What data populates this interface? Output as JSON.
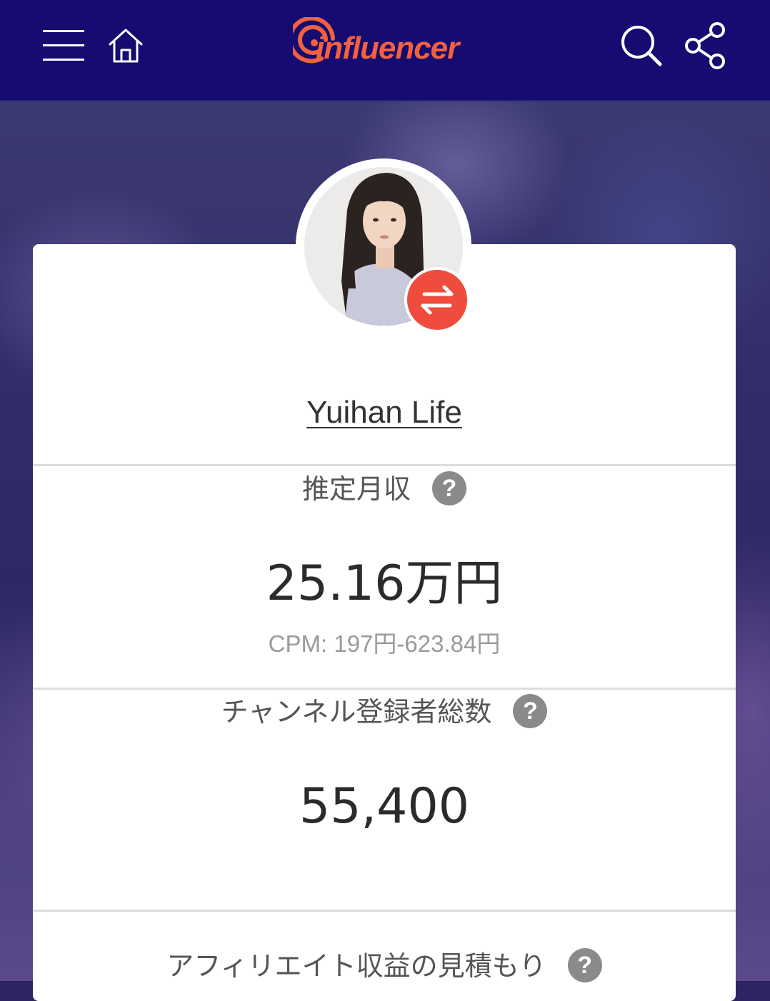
{
  "header": {
    "logo_text": "influencer",
    "icons": {
      "menu": "hamburger-menu-icon",
      "home": "home-icon",
      "search": "search-icon",
      "share": "share-icon"
    }
  },
  "profile": {
    "channel_name": "Yuihan Life",
    "swap_icon": "swap-arrows-icon"
  },
  "stats": {
    "monthly_income": {
      "label": "推定月収",
      "help": "?",
      "value": "25.16万円",
      "cpm": "CPM: 197円-623.84円"
    },
    "subscribers": {
      "label": "チャンネル登録者総数",
      "help": "?",
      "value": "55,400"
    },
    "affiliate": {
      "label": "アフィリエイト収益の見積もり",
      "help": "?"
    }
  },
  "colors": {
    "header_bg": "#150b70",
    "accent": "#f2613f",
    "badge": "#f04c3e",
    "card_bg": "#ffffff"
  }
}
